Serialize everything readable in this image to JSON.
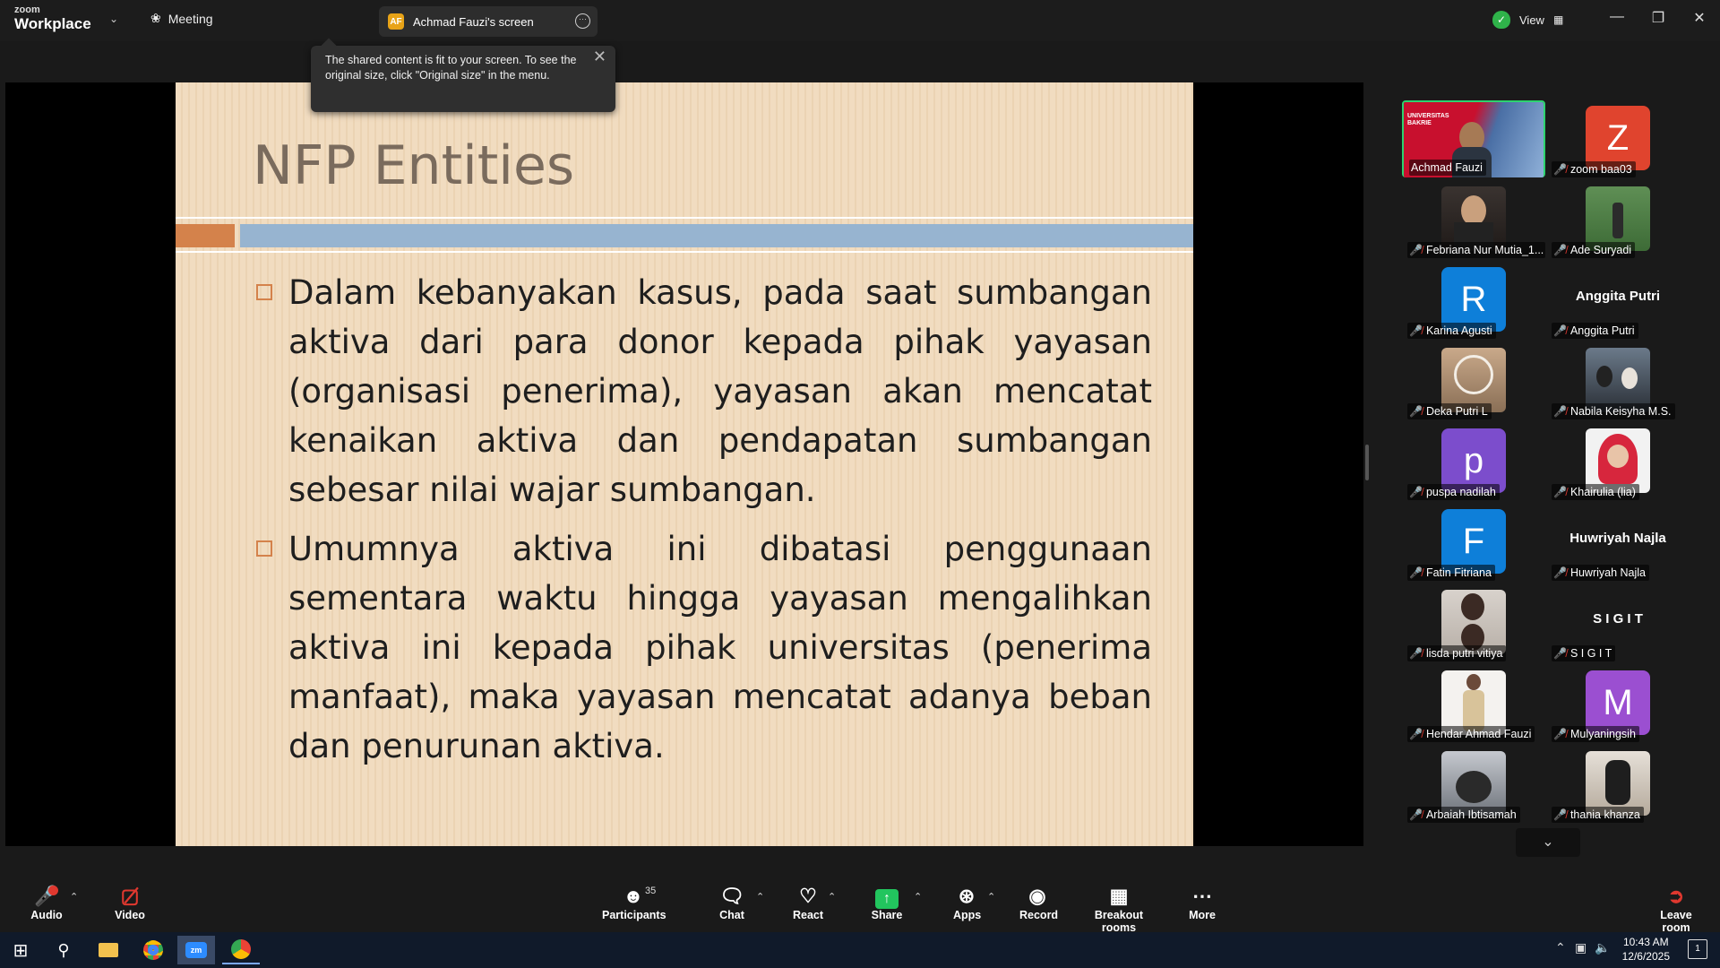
{
  "app": {
    "brand_small": "zoom",
    "brand_big": "Workplace",
    "meeting_label": "Meeting",
    "screen_tab_initials": "AF",
    "screen_tab_label": "Achmad Fauzi's screen",
    "view_label": "View"
  },
  "tooltip": {
    "text": "The shared content is fit to your screen. To see the original size, click \"Original size\" in the menu."
  },
  "slide": {
    "title": "NFP Entities",
    "bullets": [
      "Dalam kebanyakan kasus, pada saat sumbangan aktiva dari para donor kepada pihak yayasan (organisasi penerima), yayasan akan mencatat kenaikan aktiva dan pendapatan sumbangan sebesar nilai wajar sumbangan.",
      "Umumnya aktiva ini dibatasi penggunaan sementara waktu hingga yayasan mengalihkan aktiva ini kepada pihak universitas (penerima manfaat), maka yayasan mencatat adanya beban dan penurunan aktiva."
    ]
  },
  "participants": [
    {
      "name": "Achmad Fauzi",
      "kind": "photo",
      "active": true
    },
    {
      "name": "zoom baa03",
      "kind": "letter",
      "letter": "Z",
      "color": "#e0442e"
    },
    {
      "name": "Febriana Nur Mutia_1...",
      "kind": "photo"
    },
    {
      "name": "Ade Suryadi",
      "kind": "photo"
    },
    {
      "name": "Karina Agusti",
      "kind": "letter",
      "letter": "R",
      "color": "#0e7fd9"
    },
    {
      "name": "Anggita Putri",
      "kind": "text",
      "display": "Anggita Putri"
    },
    {
      "name": "Deka Putri L",
      "kind": "photo"
    },
    {
      "name": "Nabila Keisyha M.S.",
      "kind": "photo"
    },
    {
      "name": "puspa nadilah",
      "kind": "letter",
      "letter": "p",
      "color": "#7c4dcc"
    },
    {
      "name": "Khairulia (lia)",
      "kind": "photo"
    },
    {
      "name": "Fatin Fitriana",
      "kind": "letter",
      "letter": "F",
      "color": "#0e7fd9"
    },
    {
      "name": "Huwriyah Najla",
      "kind": "text",
      "display": "Huwriyah Najla"
    },
    {
      "name": "lisda putri vitiya",
      "kind": "photo"
    },
    {
      "name": "S I G I T",
      "kind": "text",
      "display": "S I G I T"
    },
    {
      "name": "Hendar Ahmad Fauzi",
      "kind": "photo"
    },
    {
      "name": "Mulyaningsih",
      "kind": "letter",
      "letter": "M",
      "color": "#9b4fd1"
    },
    {
      "name": "Arbaiah Ibtisamah",
      "kind": "photo"
    },
    {
      "name": "thania khanza",
      "kind": "photo"
    }
  ],
  "toolbar": {
    "audio": "Audio",
    "video": "Video",
    "participants": "Participants",
    "participants_count": "35",
    "chat": "Chat",
    "react": "React",
    "share": "Share",
    "apps": "Apps",
    "record": "Record",
    "breakout": "Breakout rooms",
    "more": "More",
    "leave": "Leave room"
  },
  "taskbar": {
    "time": "10:43 AM",
    "date": "12/6/2025",
    "notifications": "1"
  }
}
